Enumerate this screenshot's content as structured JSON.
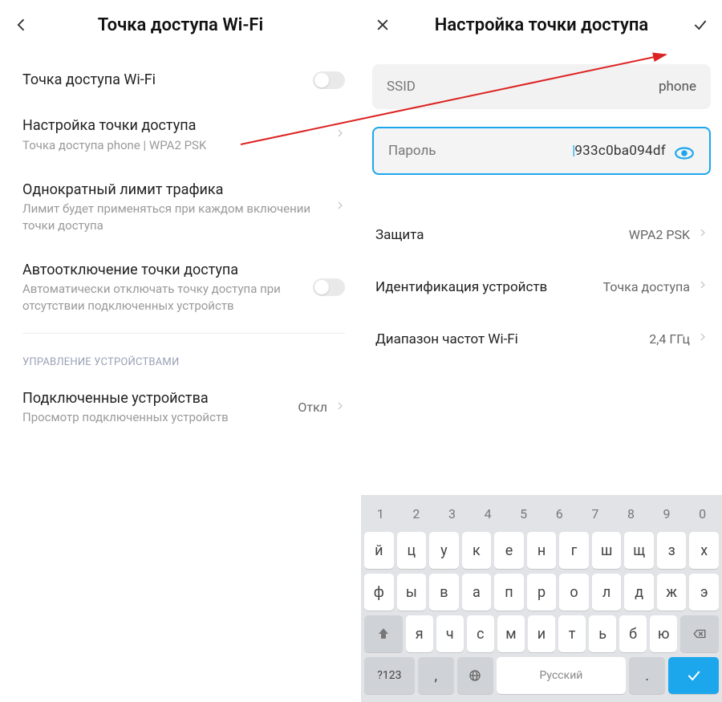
{
  "left": {
    "title": "Точка доступа Wi-Fi",
    "rows": {
      "hotspot": {
        "label": "Точка доступа Wi-Fi"
      },
      "config": {
        "label": "Настройка точки доступа",
        "sub": "Точка доступа phone | WPA2 PSK"
      },
      "limit": {
        "label": "Однократный лимит трафика",
        "sub": "Лимит будет применяться при каждом включении точки доступа"
      },
      "autooff": {
        "label": "Автоотключение точки доступа",
        "sub": "Автоматически отключать точку доступа при отсутствии подключенных устройств"
      }
    },
    "section": "УПРАВЛЕНИЕ УСТРОЙСТВАМИ",
    "connected": {
      "label": "Подключенные устройства",
      "sub": "Просмотр подключенных устройств",
      "value": "Откл"
    }
  },
  "right": {
    "title": "Настройка точки доступа",
    "ssid": {
      "label": "SSID",
      "value": "phone"
    },
    "password": {
      "label": "Пароль",
      "value": "933c0ba094df"
    },
    "security": {
      "label": "Защита",
      "value": "WPA2 PSK"
    },
    "ident": {
      "label": "Идентификация устройств",
      "value": "Точка доступа"
    },
    "band": {
      "label": "Диапазон частот Wi-Fi",
      "value": "2,4 ГГц"
    }
  },
  "keyboard": {
    "nums": [
      "1",
      "2",
      "3",
      "4",
      "5",
      "6",
      "7",
      "8",
      "9",
      "0"
    ],
    "r1": [
      "й",
      "ц",
      "у",
      "к",
      "е",
      "н",
      "г",
      "ш",
      "щ",
      "з",
      "х"
    ],
    "r2": [
      "ф",
      "ы",
      "в",
      "а",
      "п",
      "р",
      "о",
      "л",
      "д",
      "ж",
      "э"
    ],
    "r3": [
      "я",
      "ч",
      "с",
      "м",
      "и",
      "т",
      "ь",
      "б",
      "ю"
    ],
    "mode": "?123",
    "space": "Русский"
  }
}
